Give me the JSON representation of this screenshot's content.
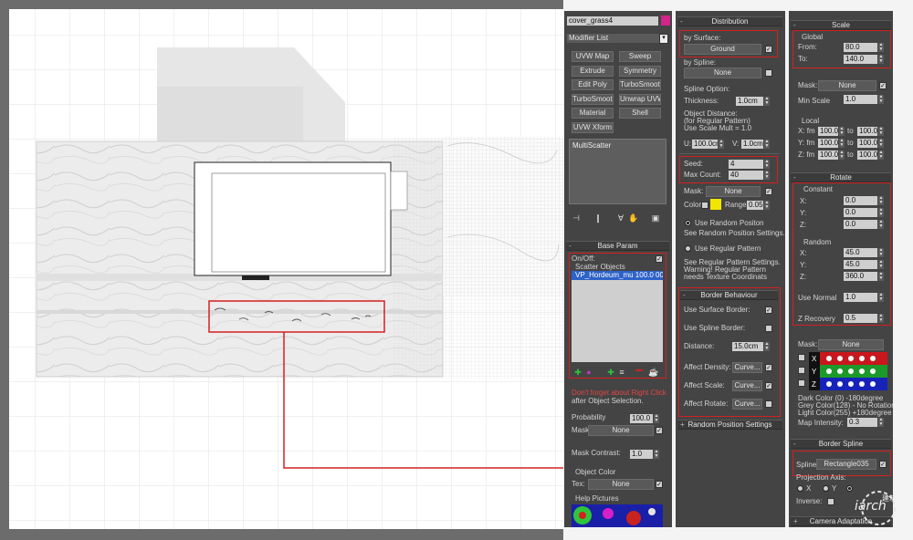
{
  "modifier_panel": {
    "object_name": "cover_grass4",
    "object_color": "#d1258a",
    "modifier_list_label": "Modifier List",
    "buttons": [
      "UVW Map",
      "Sweep",
      "Extrude",
      "Symmetry",
      "Edit Poly",
      "TurboSmooth",
      "TurboSmooth",
      "Unwrap UVW",
      "Material",
      "Shell",
      "UVW Xform"
    ],
    "stack_item": "MultiScatter",
    "base_param": {
      "title": "Base Param",
      "on_off_label": "On/Off:",
      "scatter_objects_label": "Scatter Objects",
      "scatter_item": "VP_Hordeum_mu 100.0 004",
      "warning_line1": "Don't forget about Right Click",
      "warning_line2": "after Object Selection.",
      "probability_label": "Probability",
      "probability_value": "100.0",
      "mask_label": "Mask",
      "mask_value": "None",
      "mask_contrast_label": "Mask Contrast:",
      "mask_contrast_value": "1.0",
      "object_color_label": "Object Color",
      "tex_label": "Tex:",
      "tex_value": "None",
      "help_pictures_label": "Help Pictures"
    }
  },
  "distribution": {
    "title": "Distribution",
    "by_surface_label": "by Surface:",
    "by_surface_value": "Ground",
    "by_spline_label": "by Spline:",
    "by_spline_value": "None",
    "spline_option_label": "Spline Option:",
    "thickness_label": "Thickness:",
    "thickness_value": "1.0cm",
    "object_distance_line1": "Object Distance:",
    "object_distance_line2": "(for Regular Pattern)",
    "object_distance_line3": "Use Scale Mult = 1.0",
    "u_label": "U:",
    "u_value": "100.0cr",
    "v_label": "V:",
    "v_value": "1.0cm",
    "seed_label": "Seed:",
    "seed_value": "4",
    "max_count_label": "Max Count:",
    "max_count_value": "40",
    "mask_label": "Mask:",
    "mask_value": "None",
    "color_label": "Color",
    "color_swatch": "#f2e500",
    "range_label": "Range",
    "range_value": "0.05",
    "use_random_label": "Use Random Positon",
    "see_random_label": "See Random Position Settings.",
    "use_regular_label": "Use Regular Pattern",
    "see_regular_label": "See Regular Pattern Settings.",
    "warning_line1": "Warning! Regular Pattern",
    "warning_line2": "needs Texture Coordinats"
  },
  "border_behaviour": {
    "title": "Border Behaviour",
    "use_surface_border_label": "Use Surface Border:",
    "use_spline_border_label": "Use Spline Border:",
    "distance_label": "Distance:",
    "distance_value": "15.0cm",
    "affect_density_label": "Affect Density:",
    "affect_scale_label": "Affect Scale:",
    "affect_rotate_label": "Affect Rotate:",
    "curve_label": "Curve...",
    "random_position_settings_title": "Random Position Settings"
  },
  "scale": {
    "title": "Scale",
    "global_label": "Global",
    "from_label": "From:",
    "from_value": "80.0",
    "to_label": "To:",
    "to_value": "140.0",
    "mask_label": "Mask:",
    "mask_value": "None",
    "min_scale_label": "Min Scale",
    "min_scale_value": "1.0",
    "local_label": "Local",
    "x_label": "X: fm",
    "y_label": "Y: fm",
    "z_label": "Z: fm",
    "local_from_value": "100.0",
    "to_word": "to",
    "local_to_value": "100.0"
  },
  "rotate": {
    "title": "Rotate",
    "constant_label": "Constant",
    "x_label": "X:",
    "y_label": "Y:",
    "z_label": "Z:",
    "const_x": "0.0",
    "const_y": "0.0",
    "const_z": "0.0",
    "random_label": "Random",
    "rand_x": "45.0",
    "rand_y": "45.0",
    "rand_z": "360.0",
    "use_normal_label": "Use Normal",
    "use_normal_value": "1.0",
    "z_recovery_label": "Z Recovery",
    "z_recovery_value": "0.5",
    "mask_label": "Mask:",
    "mask_value": "None",
    "dark_color_label": "Dark Color (0)    -180degree",
    "grey_color_label": "Grey Color(128) - No Rotation",
    "light_color_label": "Light Color(255)  +180degree",
    "map_intensity_label": "Map Intensity:",
    "map_intensity_value": "0.3"
  },
  "border_spline": {
    "title": "Border Spline",
    "spline_label": "Spline:",
    "spline_value": "Rectangle035",
    "projection_axis_label": "Projection Axis:",
    "axis_x": "X",
    "axis_y": "Y",
    "inverse_label": "Inverse:"
  },
  "camera_adaptation": {
    "title": "Camera Adaptation"
  },
  "watermark": {
    "line1": "iarch",
    "line2": "建筑"
  }
}
